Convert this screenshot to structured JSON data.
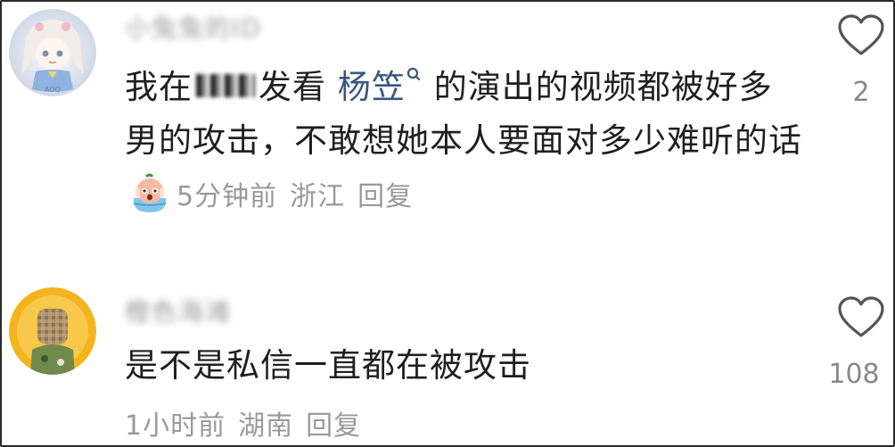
{
  "comments": [
    {
      "username": "小兔兔的ID",
      "text_before": "我在",
      "text_after_censor": "发看",
      "mention": "杨笠",
      "text_rest": "的演出的视频都被好多男的攻击，不敢想她本人要面对多少难听的话",
      "time": "5分钟前",
      "location": "浙江",
      "reply": "回复",
      "likes": "2"
    },
    {
      "username": "橙色海滩",
      "text": "是不是私信一直都在被攻击",
      "time": "1小时前",
      "location": "湖南",
      "reply": "回复",
      "likes": "108"
    }
  ],
  "colors": {
    "mention": "#38577e",
    "meta": "#999999",
    "text": "#1f1f1f"
  }
}
